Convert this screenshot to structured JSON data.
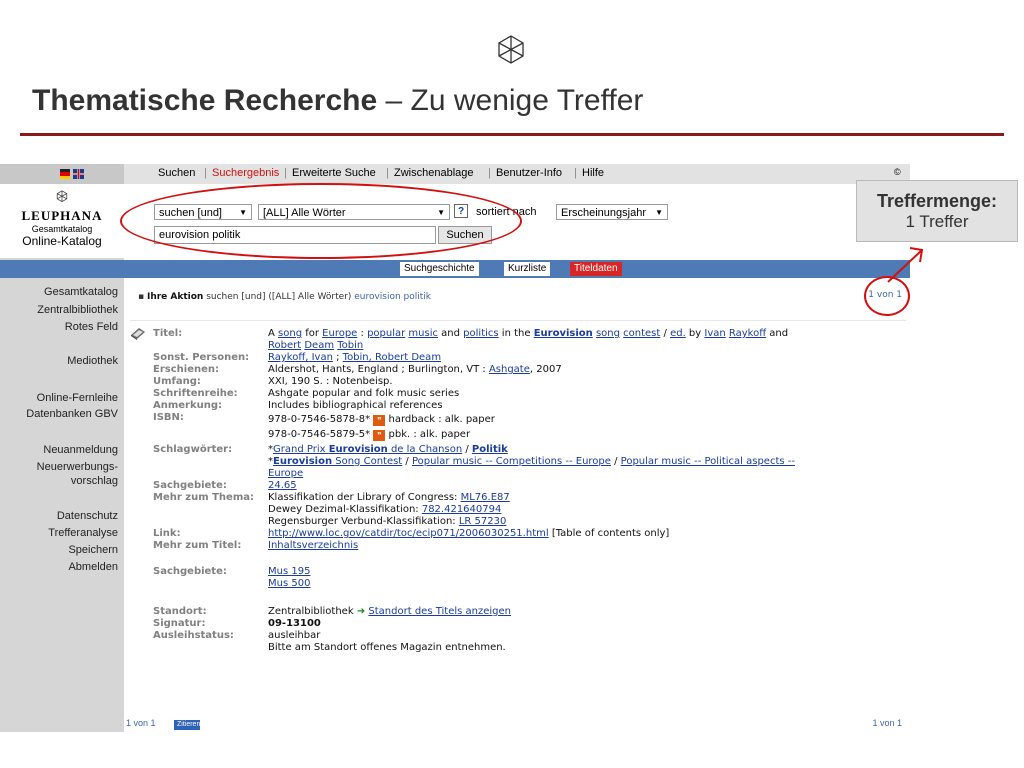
{
  "slide": {
    "title_bold": "Thematische Recherche",
    "title_rest": " – Zu wenige Treffer"
  },
  "callout": {
    "title": "Treffermenge:",
    "text": "1 Treffer"
  },
  "logo": {
    "name": "LEUPHANA",
    "sub": "Gesamtkatalog",
    "catalog": "Online-Katalog"
  },
  "topnav": {
    "items": [
      "Suchen",
      "Suchergebnis",
      "Erweiterte Suche",
      "Zwischenablage",
      "Benutzer-Info",
      "Hilfe"
    ],
    "copyright": "©"
  },
  "search": {
    "mode": "suchen [und]",
    "field": "[ALL] Alle Wörter",
    "help": "?",
    "sort_label": "sortiert nach",
    "sort_value": "Erscheinungsjahr",
    "query": "eurovision politik",
    "button": "Suchen"
  },
  "subtabs": [
    "Suchgeschichte",
    "Kurzliste",
    "Titeldaten"
  ],
  "sidebar": [
    "Gesamtkatalog",
    "Zentralbibliothek",
    "Rotes Feld",
    "Mediothek",
    "Online-Fernleihe",
    "Datenbanken GBV",
    "Neuanmeldung",
    "Neuerwerbungs-",
    "vorschlag",
    "Datenschutz",
    "Trefferanalyse",
    "Speichern",
    "Abmelden"
  ],
  "action": {
    "label": "Ihre Aktion",
    "text": " suchen [und] ([ALL] Alle Wörter) ",
    "query": "eurovision politik",
    "hits": "1 von 1"
  },
  "record": {
    "labels": {
      "titel": "Titel:",
      "personen": "Sonst. Personen:",
      "erschienen": "Erschienen:",
      "umfang": "Umfang:",
      "reihe": "Schriftenreihe:",
      "anmerkung": "Anmerkung:",
      "isbn": "ISBN:",
      "schlag": "Schlagwörter:",
      "sachgeb": "Sachgebiete:",
      "mehr_thema": "Mehr zum Thema:",
      "link": "Link:",
      "mehr_titel": "Mehr zum Titel:",
      "sachgeb2": "Sachgebiete:",
      "standort": "Standort:",
      "signatur": "Signatur:",
      "status": "Ausleihstatus:"
    },
    "titel_1": "A ",
    "titel_song": "song",
    "titel_for": " for ",
    "titel_europe": "Europe",
    "titel_colon": " : ",
    "titel_popular": "popular",
    "titel_sp1": " ",
    "titel_music": "music",
    "titel_and": " and ",
    "titel_politics": "politics",
    "titel_inthe": " in the ",
    "titel_eurovision": "Eurovision",
    "titel_sp2": " ",
    "titel_song2": "song",
    "titel_sp3": " ",
    "titel_contest": "contest",
    "titel_slash": " / ",
    "titel_ed": "ed.",
    "titel_by": " by ",
    "titel_ivan": "Ivan",
    "titel_sp4": " ",
    "titel_raykoff": "Raykoff",
    "titel_and2": " and",
    "titel_robert": "Robert",
    "titel_deam": "Deam",
    "titel_tobin": "Tobin",
    "personen_1": "Raykoff, Ivan",
    "personen_sep": " ; ",
    "personen_2": "Tobin, Robert Deam",
    "erschienen_1": "Aldershot, Hants, England ; Burlington, VT : ",
    "erschienen_ash": "Ashgate",
    "erschienen_2": ", 2007",
    "umfang": "XXI, 190 S. : Notenbeisp.",
    "reihe": "Ashgate popular and folk music series",
    "anmerkung": "Includes bibliographical references",
    "isbn_1": "978-0-7546-5878-8*",
    "isbn_1b": " hardback : alk. paper",
    "isbn_2": "978-0-7546-5879-5*",
    "isbn_2b": " pbk. : alk. paper",
    "schlag_1_star": "*",
    "schlag_1a": "Grand Prix ",
    "schlag_1b": "Eurovision",
    "schlag_1c": " de la Chanson",
    "schlag_1d": " / ",
    "schlag_1e": "Politik",
    "schlag_2_star": "*",
    "schlag_2a": "Eurovision",
    "schlag_2b": " Song Contest",
    "schlag_2c": " / ",
    "schlag_2d": "Popular music -- Competitions -- Europe",
    "schlag_2e": " / ",
    "schlag_2f": "Popular music -- Political aspects --",
    "schlag_3": "Europe",
    "sachgeb": "24.65",
    "thema_1a": "Klassifikation der Library of Congress: ",
    "thema_1b": "ML76.E87",
    "thema_2a": "Dewey Dezimal-Klassifikation: ",
    "thema_2b": "782.421640794",
    "thema_3a": "Regensburger Verbund-Klassifikation: ",
    "thema_3b": "LR 57230",
    "link_url": "http://www.loc.gov/catdir/toc/ecip071/2006030251.html",
    "link_note": " [Table of contents only]",
    "mehr_titel": "Inhaltsverzeichnis",
    "sachgeb2_1": "Mus 195",
    "sachgeb2_2": "Mus 500",
    "standort": "Zentralbibliothek",
    "standort_arrow": "➜",
    "standort_link": "Standort des Titels anzeigen",
    "signatur": "09-13100",
    "status_1": "ausleihbar",
    "status_2": "Bitte am Standort offenes Magazin entnehmen."
  },
  "footer": {
    "left": "1 von 1",
    "zitieren": "Zitieren",
    "right": "1 von 1"
  },
  "colors": {
    "accent_red": "#d21010",
    "nav_blue": "#4e7ab5",
    "link_blue": "#1a3c9a",
    "rule": "#8a1a1a"
  },
  "icons": [
    "leuphana-logo-icon",
    "flag-icon",
    "book-icon",
    "reference-icon",
    "arrow-right-icon"
  ]
}
